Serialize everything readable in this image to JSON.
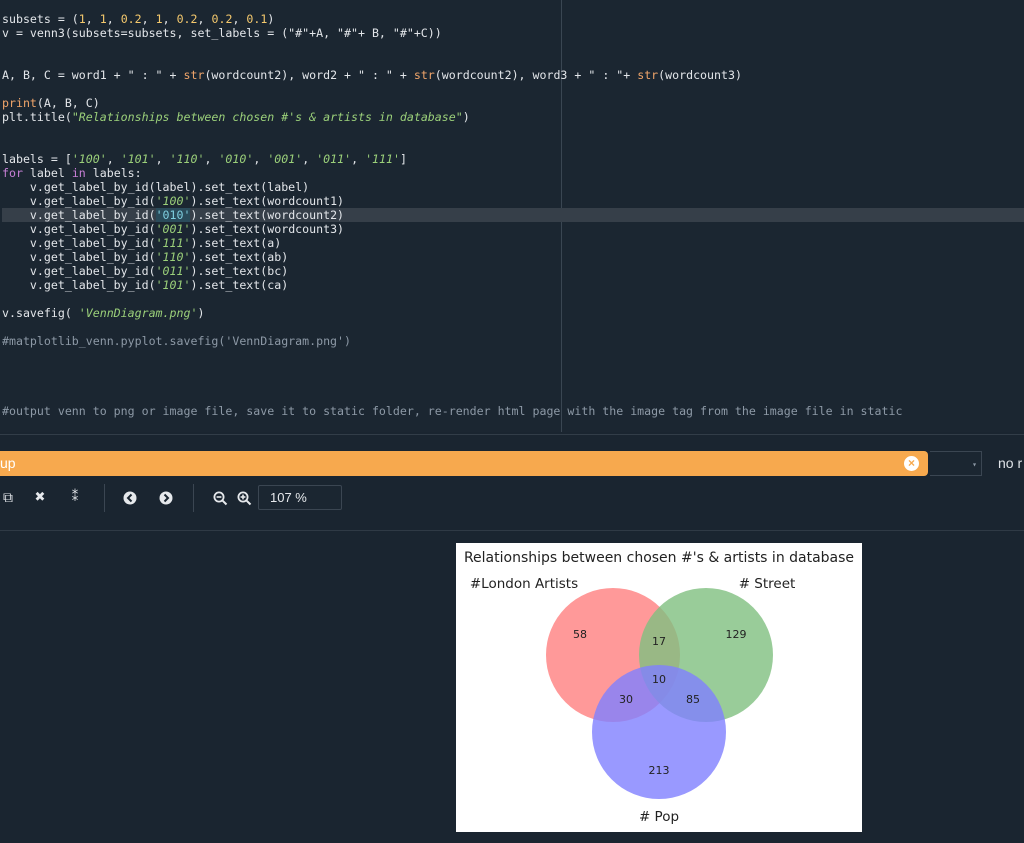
{
  "editor": {
    "lines": [
      {
        "html": "subsets = (<span class=\"num\">1</span>, <span class=\"num\">1</span>, <span class=\"num\">0.2</span>, <span class=\"num\">1</span>, <span class=\"num\">0.2</span>, <span class=\"num\">0.2</span>, <span class=\"num\">0.1</span>)"
      },
      {
        "html": "v = venn3(subsets=subsets, set_labels = (\"#\"+A, \"#\"+ B, \"#\"+C))"
      },
      {
        "html": ""
      },
      {
        "html": ""
      },
      {
        "html": "A, B, C = word1 + \" : \" + <span class=\"fn\">str</span>(wordcount2), word2 + \" : \" + <span class=\"fn\">str</span>(wordcount2), word3 + \" : \"+ <span class=\"fn\">str</span>(wordcount3)"
      },
      {
        "html": ""
      },
      {
        "html": "<span class=\"fn\">print</span>(A, B, C)"
      },
      {
        "html": "plt.title(<span class=\"str\">\"Relationships between chosen #'s &amp; artists in database\"</span>)"
      },
      {
        "html": ""
      },
      {
        "html": ""
      },
      {
        "html": "labels = [<span class=\"str\">'100'</span>, <span class=\"str\">'101'</span>, <span class=\"str\">'110'</span>, <span class=\"str\">'010'</span>, <span class=\"str\">'001'</span>, <span class=\"str\">'011'</span>, <span class=\"str\">'111'</span>]"
      },
      {
        "html": "<span class=\"kw\">for</span> label <span class=\"kw\">in</span> labels:"
      },
      {
        "html": "    v.get_label_by_id(label).set_text(label)"
      },
      {
        "html": "    v.get_label_by_id(<span class=\"str\">'100'</span>).set_text(wordcount1)"
      },
      {
        "html": "    v.get_label_by_id(<span class=\"sel\">'010'</span>).set_text(wordcount2)",
        "highlight": true
      },
      {
        "html": "    v.get_label_by_id(<span class=\"str\">'001'</span>).set_text(wordcount3)"
      },
      {
        "html": "    v.get_label_by_id(<span class=\"str\">'111'</span>).set_text(a)"
      },
      {
        "html": "    v.get_label_by_id(<span class=\"str\">'110'</span>).set_text(ab)"
      },
      {
        "html": "    v.get_label_by_id(<span class=\"str\">'011'</span>).set_text(bc)"
      },
      {
        "html": "    v.get_label_by_id(<span class=\"str\">'101'</span>).set_text(ca)"
      },
      {
        "html": ""
      },
      {
        "html": "v.savefig( <span class=\"str\">'VennDiagram.png'</span>)"
      },
      {
        "html": ""
      },
      {
        "html": "<span class=\"cm\">#matplotlib_venn.pyplot.savefig('VennDiagram.png')</span>"
      },
      {
        "html": ""
      },
      {
        "html": ""
      },
      {
        "html": ""
      },
      {
        "html": ""
      },
      {
        "html": "<span class=\"cm\">#output venn to png or image file, save it to static folder, re-render html page with the image tag from the image file in static</span>"
      }
    ]
  },
  "find_bar": {
    "query": "up",
    "clear_icon": "×",
    "dropdown_icon": "▾",
    "option_text": "no r"
  },
  "toolbar": {
    "copy_icon": "⧉",
    "close_icon": "✖",
    "collapse_icon": "⁑",
    "back_icon": "◀",
    "forward_icon": "▶",
    "zoom_out_icon": "⊖",
    "zoom_in_icon": "⊕",
    "zoom_value": "107 %"
  },
  "colors": {
    "editor_bg": "#1b2631",
    "find_bar": "#f7a94e",
    "venn_a": "#ff7f7f",
    "venn_b": "#7fbf7f",
    "venn_c": "#7f7fff"
  },
  "chart_data": {
    "type": "venn3",
    "title": "Relationships between chosen #'s & artists in database",
    "set_labels": [
      "#London Artists",
      "# Street",
      "# Pop"
    ],
    "regions": [
      {
        "id": "100",
        "value": 58
      },
      {
        "id": "010",
        "value": 129
      },
      {
        "id": "001",
        "value": 213
      },
      {
        "id": "110",
        "value": 17
      },
      {
        "id": "101",
        "value": 30
      },
      {
        "id": "011",
        "value": 85
      },
      {
        "id": "111",
        "value": 10
      }
    ],
    "colors": [
      "#ff7f7f",
      "#7fbf7f",
      "#7f7fff"
    ]
  }
}
